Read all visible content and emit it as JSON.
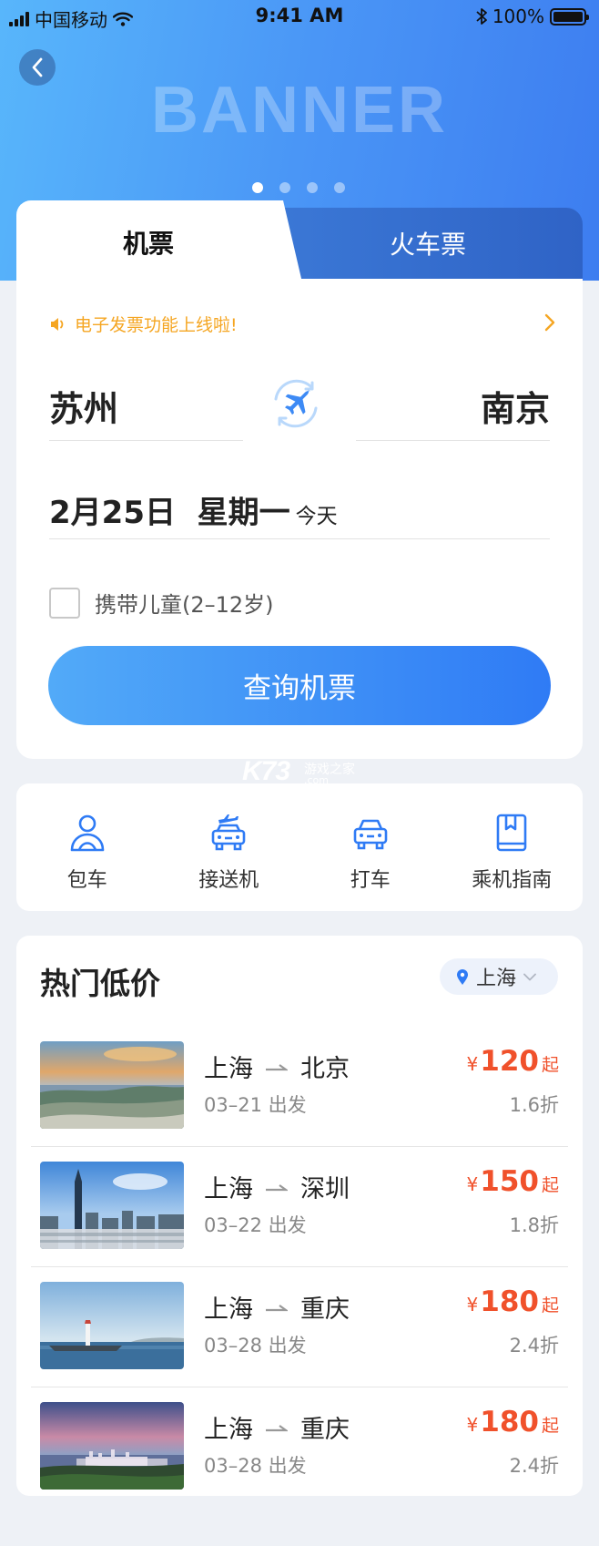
{
  "status_bar": {
    "carrier": "中国移动",
    "time": "9:41 AM",
    "battery": "100%"
  },
  "banner": {
    "text": "BANNER",
    "dot_count": 4,
    "active_dot": 0
  },
  "tabs": {
    "flight": "机票",
    "train": "火车票",
    "active": "flight"
  },
  "notice": {
    "text": "电子发票功能上线啦!"
  },
  "search": {
    "from_city": "苏州",
    "to_city": "南京",
    "date": "2月25日  星期一",
    "date_note": "今天",
    "child_option": "携带儿童(2–12岁)",
    "child_checked": false,
    "button": "查询机票"
  },
  "watermark": {
    "logo": "K73",
    "sub_cn": "游戏之家",
    "sub_en": ".com"
  },
  "services": [
    {
      "label": "包车",
      "icon": "person-icon"
    },
    {
      "label": "接送机",
      "icon": "airport-car-icon"
    },
    {
      "label": "打车",
      "icon": "car-icon"
    },
    {
      "label": "乘机指南",
      "icon": "guide-book-icon"
    }
  ],
  "hot_deals": {
    "title": "热门低价",
    "location": "上海",
    "routes": [
      {
        "from": "上海",
        "to": "北京",
        "date": "03–21 出发",
        "currency": "¥",
        "price": "120",
        "suffix": "起",
        "discount": "1.6折",
        "thumb": "coastal-city-sunset"
      },
      {
        "from": "上海",
        "to": "深圳",
        "date": "03–22 出发",
        "currency": "¥",
        "price": "150",
        "suffix": "起",
        "discount": "1.8折",
        "thumb": "skyscraper-city"
      },
      {
        "from": "上海",
        "to": "重庆",
        "date": "03–28 出发",
        "currency": "¥",
        "price": "180",
        "suffix": "起",
        "discount": "2.4折",
        "thumb": "lighthouse-harbor"
      },
      {
        "from": "上海",
        "to": "重庆",
        "date": "03–28 出发",
        "currency": "¥",
        "price": "180",
        "suffix": "起",
        "discount": "2.4折",
        "thumb": "bay-city-dusk"
      }
    ]
  },
  "colors": {
    "accent": "#3d7df0",
    "price": "#f0512b",
    "notice": "#f5a623"
  }
}
